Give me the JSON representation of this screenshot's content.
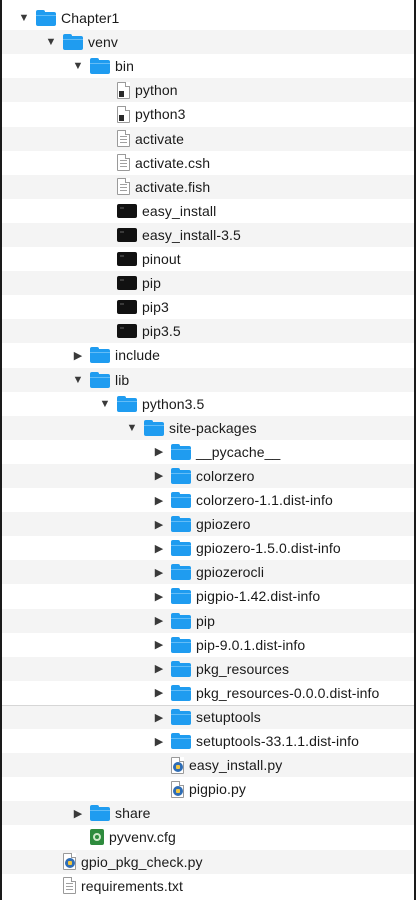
{
  "file_tree": {
    "rows": [
      {
        "label": "Chapter1",
        "type": "folder",
        "state": "expanded",
        "depth": 0
      },
      {
        "label": "venv",
        "type": "folder",
        "state": "expanded",
        "depth": 1
      },
      {
        "label": "bin",
        "type": "folder",
        "state": "expanded",
        "depth": 2
      },
      {
        "label": "python",
        "type": "symlink-file",
        "depth": 3
      },
      {
        "label": "python3",
        "type": "symlink-file",
        "depth": 3
      },
      {
        "label": "activate",
        "type": "text-file",
        "depth": 3
      },
      {
        "label": "activate.csh",
        "type": "text-file",
        "depth": 3
      },
      {
        "label": "activate.fish",
        "type": "text-file",
        "depth": 3
      },
      {
        "label": "easy_install",
        "type": "executable",
        "depth": 3
      },
      {
        "label": "easy_install-3.5",
        "type": "executable",
        "depth": 3
      },
      {
        "label": "pinout",
        "type": "executable",
        "depth": 3
      },
      {
        "label": "pip",
        "type": "executable",
        "depth": 3
      },
      {
        "label": "pip3",
        "type": "executable",
        "depth": 3
      },
      {
        "label": "pip3.5",
        "type": "executable",
        "depth": 3
      },
      {
        "label": "include",
        "type": "folder",
        "state": "collapsed",
        "depth": 2
      },
      {
        "label": "lib",
        "type": "folder",
        "state": "expanded",
        "depth": 2
      },
      {
        "label": "python3.5",
        "type": "folder",
        "state": "expanded",
        "depth": 3
      },
      {
        "label": "site-packages",
        "type": "folder",
        "state": "expanded",
        "depth": 4
      },
      {
        "label": "__pycache__",
        "type": "folder",
        "state": "collapsed",
        "depth": 5
      },
      {
        "label": "colorzero",
        "type": "folder",
        "state": "collapsed",
        "depth": 5
      },
      {
        "label": "colorzero-1.1.dist-info",
        "type": "folder",
        "state": "collapsed",
        "depth": 5
      },
      {
        "label": "gpiozero",
        "type": "folder",
        "state": "collapsed",
        "depth": 5
      },
      {
        "label": "gpiozero-1.5.0.dist-info",
        "type": "folder",
        "state": "collapsed",
        "depth": 5
      },
      {
        "label": "gpiozerocli",
        "type": "folder",
        "state": "collapsed",
        "depth": 5
      },
      {
        "label": "pigpio-1.42.dist-info",
        "type": "folder",
        "state": "collapsed",
        "depth": 5
      },
      {
        "label": "pip",
        "type": "folder",
        "state": "collapsed",
        "depth": 5
      },
      {
        "label": "pip-9.0.1.dist-info",
        "type": "folder",
        "state": "collapsed",
        "depth": 5
      },
      {
        "label": "pkg_resources",
        "type": "folder",
        "state": "collapsed",
        "depth": 5
      },
      {
        "label": "pkg_resources-0.0.0.dist-info",
        "type": "folder",
        "state": "collapsed",
        "depth": 5
      },
      {
        "label": "setuptools",
        "type": "folder",
        "state": "collapsed",
        "depth": 5
      },
      {
        "label": "setuptools-33.1.1.dist-info",
        "type": "folder",
        "state": "collapsed",
        "depth": 5
      },
      {
        "label": "easy_install.py",
        "type": "python-file",
        "depth": 5
      },
      {
        "label": "pigpio.py",
        "type": "python-file",
        "depth": 5
      },
      {
        "label": "share",
        "type": "folder",
        "state": "collapsed",
        "depth": 2
      },
      {
        "label": "pyvenv.cfg",
        "type": "config-file",
        "depth": 2
      },
      {
        "label": "gpio_pkg_check.py",
        "type": "python-file",
        "depth": 1
      },
      {
        "label": "requirements.txt",
        "type": "text-file",
        "depth": 1
      }
    ],
    "icons": {
      "expanded": "disclosure-expanded-icon",
      "collapsed": "disclosure-collapsed-icon",
      "folder": "folder-icon",
      "symlink-file": "executable-document-icon",
      "text-file": "document-icon",
      "executable": "terminal-executable-icon",
      "python-file": "python-document-icon",
      "config-file": "config-document-icon"
    },
    "colors": {
      "folder": "#1f9cf0",
      "alternate_row": "#f4f4f4"
    }
  }
}
